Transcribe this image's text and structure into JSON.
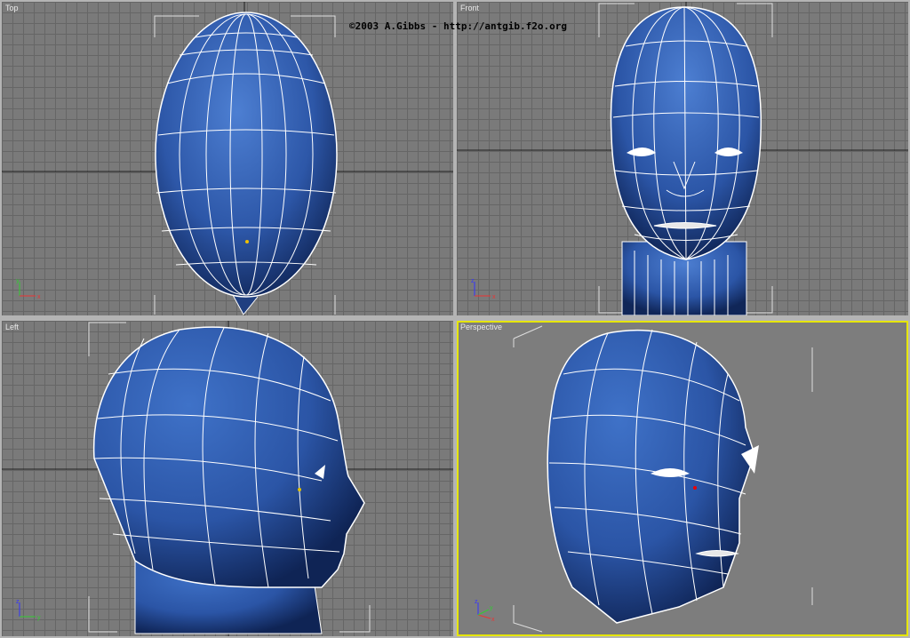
{
  "copyright": "©2003 A.Gibbs - http://antgib.f2o.org",
  "viewports": {
    "top": {
      "label": "Top"
    },
    "front": {
      "label": "Front"
    },
    "left": {
      "label": "Left"
    },
    "perspective": {
      "label": "Perspective",
      "active": true
    }
  },
  "gizmo": {
    "x": "x",
    "y": "y",
    "z": "z"
  },
  "colors": {
    "mesh": "#2d57a8",
    "wire": "#ffffff",
    "active_border": "#e6e600",
    "grid": "#666666",
    "axis": "#202020"
  }
}
